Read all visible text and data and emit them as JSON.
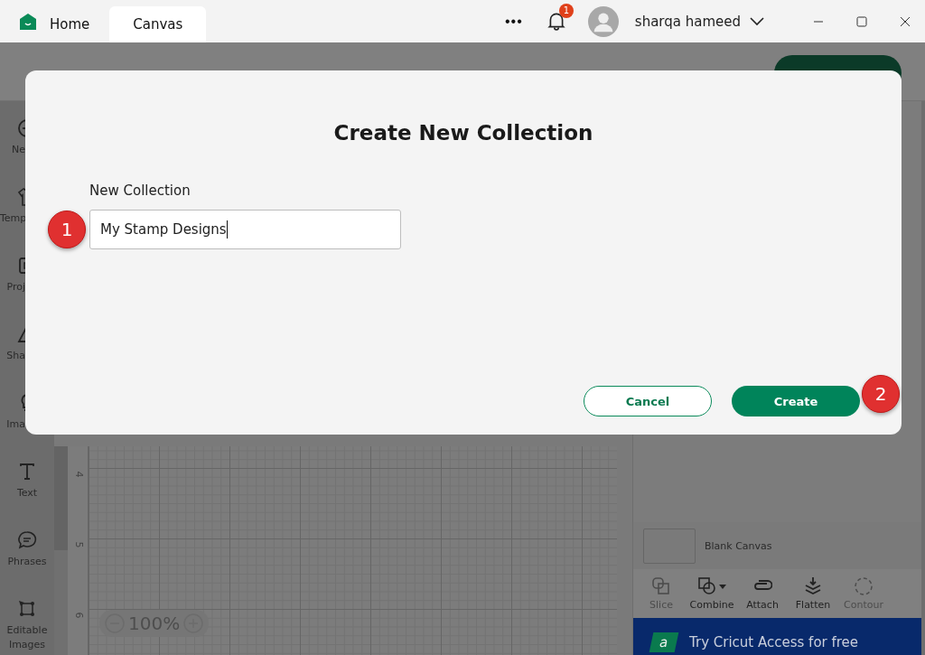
{
  "title_bar": {
    "tabs": [
      {
        "label": "Home",
        "selected": false
      },
      {
        "label": "Canvas",
        "selected": true
      }
    ],
    "more": "•••",
    "notifications": {
      "count": "1"
    },
    "user": {
      "name": "sharqa hameed"
    }
  },
  "sidebar": {
    "items": [
      {
        "label": "Ne",
        "cut": true
      },
      {
        "label": "Temp",
        "cut": true
      },
      {
        "label": "Proj",
        "cut": true
      },
      {
        "label": "Sha",
        "cut": true
      },
      {
        "label": "Ima",
        "cut": true
      },
      {
        "label": "Text",
        "cut": false
      },
      {
        "label": "Phrases",
        "cut": false
      },
      {
        "label": "Editable Images",
        "cut": false
      }
    ]
  },
  "canvas": {
    "ruler": [
      "4",
      "5",
      "6"
    ],
    "zoom": "100%"
  },
  "layers": {
    "items": [
      {
        "label": "Blank Canvas"
      }
    ]
  },
  "tools": [
    {
      "label": "Slice",
      "disabled": true,
      "dropdown": false
    },
    {
      "label": "Combine",
      "disabled": false,
      "dropdown": true
    },
    {
      "label": "Attach",
      "disabled": false,
      "dropdown": false
    },
    {
      "label": "Flatten",
      "disabled": false,
      "dropdown": false
    },
    {
      "label": "Contour",
      "disabled": true,
      "dropdown": false
    }
  ],
  "banner": {
    "logo": "a",
    "text": "Try Cricut Access for free"
  },
  "dialog": {
    "title": "Create New Collection",
    "field": {
      "label": "New Collection",
      "value": "My Stamp Designs",
      "focused": true
    },
    "buttons": [
      {
        "label": "Cancel",
        "kind": "secondary"
      },
      {
        "label": "Create",
        "kind": "primary"
      }
    ]
  },
  "callouts": [
    "1",
    "2"
  ]
}
